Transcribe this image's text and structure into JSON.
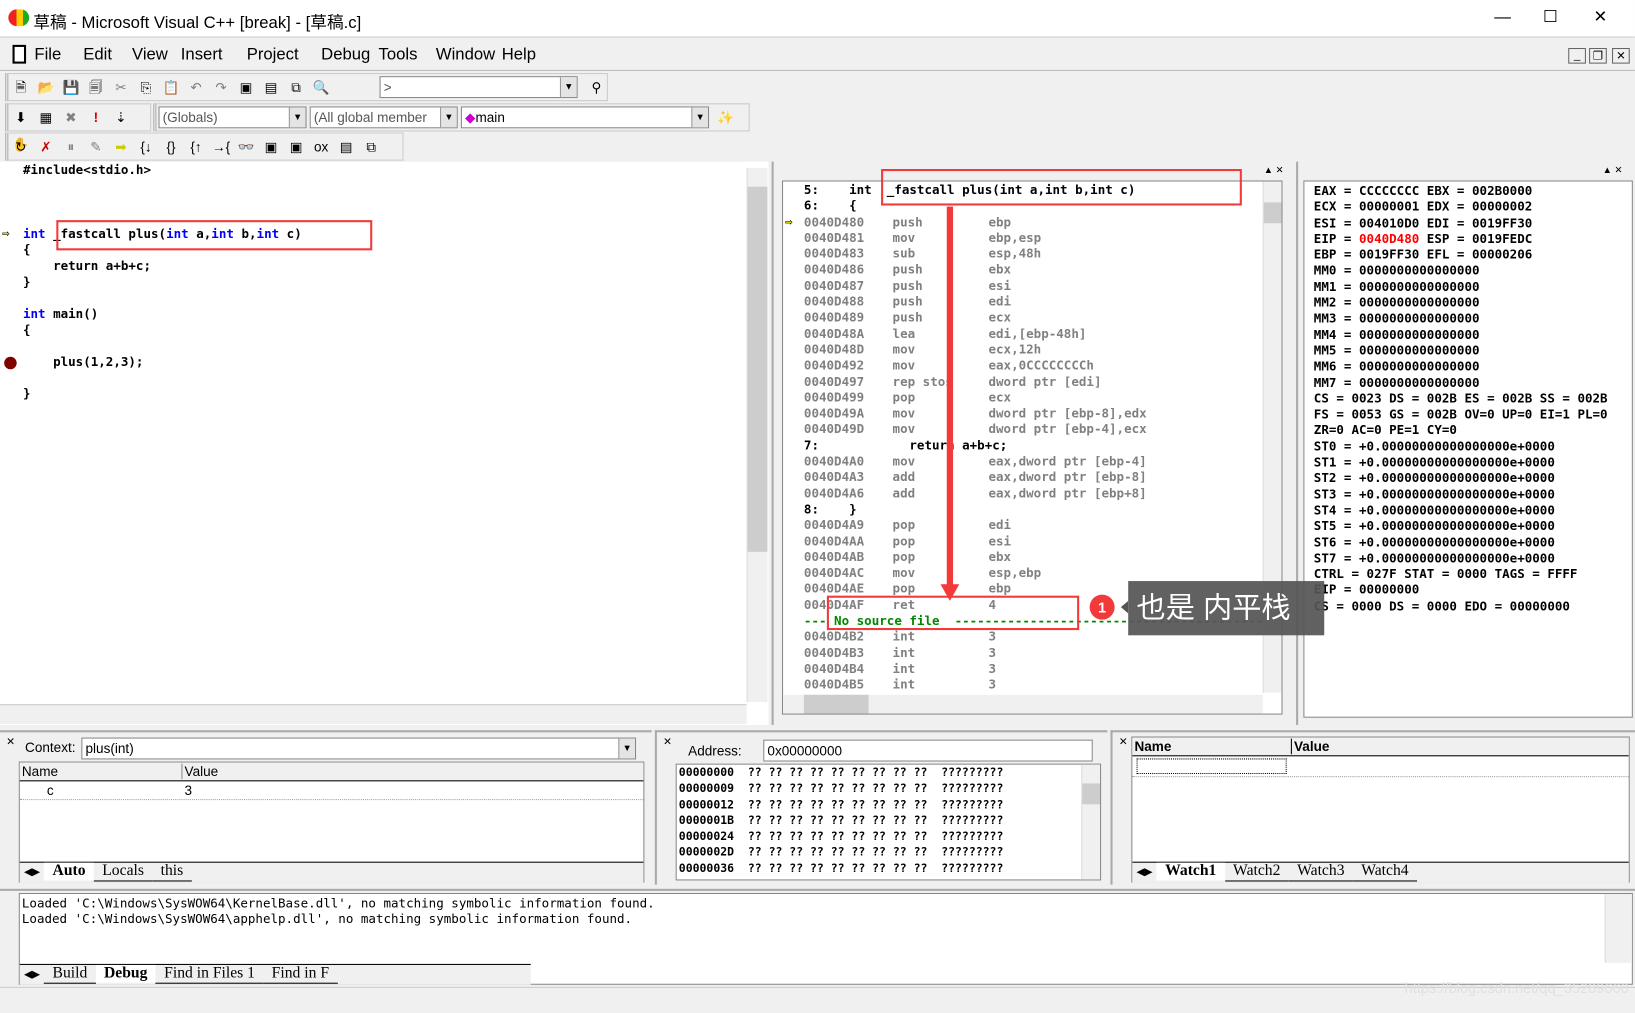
{
  "window": {
    "title": "草稿 - Microsoft Visual C++ [break] - [草稿.c]",
    "minimize": "—",
    "maximize": "☐",
    "close": "✕"
  },
  "menu": [
    "File",
    "Edit",
    "View",
    "Insert",
    "Project",
    "Debug",
    "Tools",
    "Window",
    "Help"
  ],
  "toolbar": {
    "find_combo": ">",
    "globals": "(Globals)",
    "members": "(All global member",
    "function": "main"
  },
  "source": {
    "lines": [
      {
        "t": "#include<stdio.h>"
      },
      {
        "t": ""
      },
      {
        "t": ""
      },
      {
        "t": ""
      },
      {
        "t": "int _fastcall plus(int a,int b,int c)",
        "arrow": true
      },
      {
        "t": "{"
      },
      {
        "t": "    return a+b+c;"
      },
      {
        "t": "}"
      },
      {
        "t": ""
      },
      {
        "t": "int main()"
      },
      {
        "t": "{"
      },
      {
        "t": ""
      },
      {
        "t": "    plus(1,2,3);",
        "bp": true
      },
      {
        "t": ""
      },
      {
        "t": "}"
      }
    ]
  },
  "disasm": {
    "lines": [
      {
        "src": "5:    int  _fastcall plus(int a,int b,int c)"
      },
      {
        "src": "6:    {"
      },
      {
        "a": "0040D480",
        "m": "push",
        "o": "ebp",
        "cur": true
      },
      {
        "a": "0040D481",
        "m": "mov",
        "o": "ebp,esp"
      },
      {
        "a": "0040D483",
        "m": "sub",
        "o": "esp,48h"
      },
      {
        "a": "0040D486",
        "m": "push",
        "o": "ebx"
      },
      {
        "a": "0040D487",
        "m": "push",
        "o": "esi"
      },
      {
        "a": "0040D488",
        "m": "push",
        "o": "edi"
      },
      {
        "a": "0040D489",
        "m": "push",
        "o": "ecx"
      },
      {
        "a": "0040D48A",
        "m": "lea",
        "o": "edi,[ebp-48h]"
      },
      {
        "a": "0040D48D",
        "m": "mov",
        "o": "ecx,12h"
      },
      {
        "a": "0040D492",
        "m": "mov",
        "o": "eax,0CCCCCCCCh"
      },
      {
        "a": "0040D497",
        "m": "rep stos",
        "o": "dword ptr [edi]"
      },
      {
        "a": "0040D499",
        "m": "pop",
        "o": "ecx"
      },
      {
        "a": "0040D49A",
        "m": "mov",
        "o": "dword ptr [ebp-8],edx"
      },
      {
        "a": "0040D49D",
        "m": "mov",
        "o": "dword ptr [ebp-4],ecx"
      },
      {
        "src": "7:            return a+b+c;"
      },
      {
        "a": "0040D4A0",
        "m": "mov",
        "o": "eax,dword ptr [ebp-4]"
      },
      {
        "a": "0040D4A3",
        "m": "add",
        "o": "eax,dword ptr [ebp-8]"
      },
      {
        "a": "0040D4A6",
        "m": "add",
        "o": "eax,dword ptr [ebp+8]"
      },
      {
        "src": "8:    }"
      },
      {
        "a": "0040D4A9",
        "m": "pop",
        "o": "edi"
      },
      {
        "a": "0040D4AA",
        "m": "pop",
        "o": "esi"
      },
      {
        "a": "0040D4AB",
        "m": "pop",
        "o": "ebx"
      },
      {
        "a": "0040D4AC",
        "m": "mov",
        "o": "esp,ebp"
      },
      {
        "a": "0040D4AE",
        "m": "pop",
        "o": "ebp"
      },
      {
        "a": "0040D4AF",
        "m": "ret",
        "o": "4"
      },
      {
        "nosrc": "--- No source file  -----------------------------------------------"
      },
      {
        "a": "0040D4B2",
        "m": "int",
        "o": "3"
      },
      {
        "a": "0040D4B3",
        "m": "int",
        "o": "3"
      },
      {
        "a": "0040D4B4",
        "m": "int",
        "o": "3"
      },
      {
        "a": "0040D4B5",
        "m": "int",
        "o": "3"
      }
    ]
  },
  "registers": {
    "highlight_color": "#ff0000",
    "lines": [
      {
        "pre": "EAX = CCCCCCCC EBX = 002B0000"
      },
      {
        "pre": "ECX = 00000001 EDX = 00000002"
      },
      {
        "pre": "ESI = 004010D0 EDI = 0019FF30"
      },
      {
        "pre": "EIP = ",
        "hl": "0040D480",
        "post": " ESP = 0019FEDC"
      },
      {
        "pre": "EBP = 0019FF30 EFL = 00000206"
      },
      {
        "pre": "MM0 = 0000000000000000"
      },
      {
        "pre": "MM1 = 0000000000000000"
      },
      {
        "pre": "MM2 = 0000000000000000"
      },
      {
        "pre": "MM3 = 0000000000000000"
      },
      {
        "pre": "MM4 = 0000000000000000"
      },
      {
        "pre": "MM5 = 0000000000000000"
      },
      {
        "pre": "MM6 = 0000000000000000"
      },
      {
        "pre": "MM7 = 0000000000000000"
      },
      {
        "pre": "CS = 0023 DS = 002B ES = 002B SS = 002B"
      },
      {
        "pre": "FS = 0053 GS = 002B OV=0 UP=0 EI=1 PL=0"
      },
      {
        "pre": "ZR=0 AC=0 PE=1 CY=0"
      },
      {
        "pre": "ST0 = +0.00000000000000000e+0000"
      },
      {
        "pre": "ST1 = +0.00000000000000000e+0000"
      },
      {
        "pre": "ST2 = +0.00000000000000000e+0000"
      },
      {
        "pre": "ST3 = +0.00000000000000000e+0000"
      },
      {
        "pre": "ST4 = +0.00000000000000000e+0000"
      },
      {
        "pre": "ST5 = +0.00000000000000000e+0000"
      },
      {
        "pre": "ST6 = +0.00000000000000000e+0000"
      },
      {
        "pre": "ST7 = +0.00000000000000000e+0000"
      },
      {
        "pre": "CTRL = 027F STAT = 0000 TAGS = FFFF"
      },
      {
        "pre": "EIP = 00000000"
      },
      {
        "pre": "CS = 0000 DS = 0000 EDO = 00000000"
      }
    ]
  },
  "variables": {
    "context_label": "Context:",
    "context": "plus(int)",
    "headers": [
      "Name",
      "Value"
    ],
    "rows": [
      {
        "name": "c",
        "value": "3"
      }
    ],
    "tabs": [
      "Auto",
      "Locals",
      "this"
    ]
  },
  "memory": {
    "address_label": "Address:",
    "address": "0x00000000",
    "rows": [
      "00000000  ?? ?? ?? ?? ?? ?? ?? ?? ??  ?????????",
      "00000009  ?? ?? ?? ?? ?? ?? ?? ?? ??  ?????????",
      "00000012  ?? ?? ?? ?? ?? ?? ?? ?? ??  ?????????",
      "0000001B  ?? ?? ?? ?? ?? ?? ?? ?? ??  ?????????",
      "00000024  ?? ?? ?? ?? ?? ?? ?? ?? ??  ?????????",
      "0000002D  ?? ?? ?? ?? ?? ?? ?? ?? ??  ?????????",
      "00000036  ?? ?? ?? ?? ?? ?? ?? ?? ??  ?????????"
    ]
  },
  "watch": {
    "headers": [
      "Name",
      "Value"
    ],
    "tabs": [
      "Watch1",
      "Watch2",
      "Watch3",
      "Watch4"
    ]
  },
  "output": {
    "lines": [
      "Loaded 'C:\\Windows\\SysWOW64\\KernelBase.dll', no matching symbolic information found.",
      "Loaded 'C:\\Windows\\SysWOW64\\apphelp.dll', no matching symbolic information found."
    ],
    "tabs": [
      "Build",
      "Debug",
      "Find in Files 1",
      "Find in F"
    ]
  },
  "annotation": {
    "badge": "1",
    "text": "也是 内平栈",
    "color": "#f23a3a"
  },
  "watermark": "https://blog.csdn.net/qq_35289660"
}
